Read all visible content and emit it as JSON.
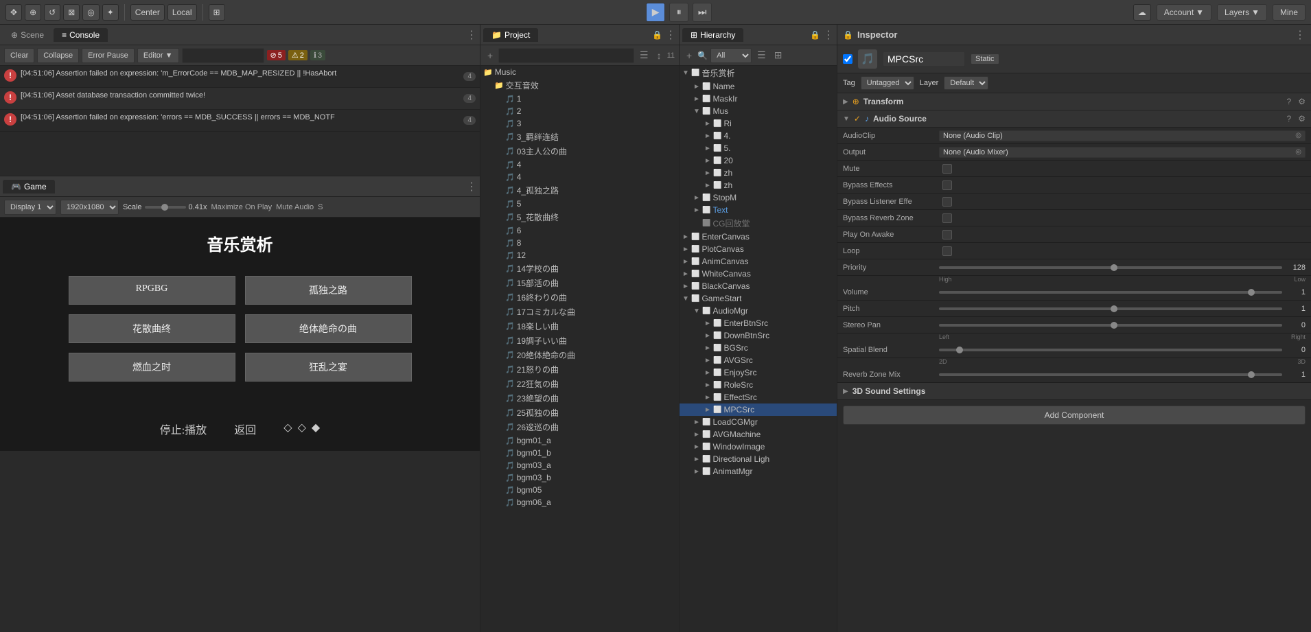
{
  "toolbar": {
    "tools": [
      "✥",
      "⊕",
      "↺",
      "⊠",
      "◎",
      "✦"
    ],
    "pivot_labels": [
      "Center",
      "Local"
    ],
    "grid_label": "⊞",
    "play_btn": "▶",
    "pause_btn": "⏸",
    "step_btn": "⏭",
    "account_label": "Account",
    "layers_label": "Layers",
    "mine_label": "Mine"
  },
  "console": {
    "tab_scene": "Scene",
    "tab_console": "Console",
    "btn_clear": "Clear",
    "btn_collapse": "Collapse",
    "btn_errorpause": "Error Pause",
    "btn_editor": "Editor ▼",
    "badge_error_count": "5",
    "badge_warn_count": "2",
    "badge_info_count": "3",
    "messages": [
      {
        "type": "error",
        "text": "[04:51:06] Assertion failed on expression: 'm_ErrorCode == MDB_MAP_RESIZED || !HasAbort",
        "count": "4"
      },
      {
        "type": "error",
        "text": "[04:51:06] Asset database transaction committed twice!",
        "count": "4"
      },
      {
        "type": "error",
        "text": "[04:51:06] Assertion failed on expression: 'errors == MDB_SUCCESS || errors == MDB_NOTF",
        "count": "4"
      }
    ]
  },
  "game": {
    "tab_label": "Game",
    "display_label": "Display 1",
    "resolution": "1920x1080",
    "scale_label": "Scale",
    "scale_value": "0.41x",
    "maximize_label": "Maximize On Play",
    "mute_label": "Mute Audio",
    "s_label": "S",
    "title": "音乐赏析",
    "buttons": [
      "RPGBG",
      "孤独之路",
      "花散曲终",
      "绝体絶命の曲",
      "燃血之时",
      "狂乱之宴"
    ],
    "bottom_stop": "停止:播放",
    "bottom_return": "返回",
    "bottom_icons": [
      "◇",
      "◇",
      "◆"
    ]
  },
  "project": {
    "tab_label": "Project",
    "lock_icon": "🔒",
    "menu_icon": "⋮",
    "add_btn": "+",
    "search_placeholder": "",
    "tree_items": [
      {
        "label": "Music",
        "type": "folder",
        "indent": 0
      },
      {
        "label": "交互音效",
        "type": "folder",
        "indent": 1
      },
      {
        "label": "1",
        "type": "music",
        "indent": 2
      },
      {
        "label": "2",
        "type": "music",
        "indent": 2
      },
      {
        "label": "3",
        "type": "music",
        "indent": 2
      },
      {
        "label": "3_羁绊连结",
        "type": "music",
        "indent": 2
      },
      {
        "label": "03主人公の曲",
        "type": "music",
        "indent": 2
      },
      {
        "label": "4",
        "type": "music",
        "indent": 2
      },
      {
        "label": "4",
        "type": "music",
        "indent": 2
      },
      {
        "label": "4_孤独之路",
        "type": "music",
        "indent": 2
      },
      {
        "label": "5",
        "type": "music",
        "indent": 2
      },
      {
        "label": "5_花散曲终",
        "type": "music",
        "indent": 2
      },
      {
        "label": "6",
        "type": "music",
        "indent": 2
      },
      {
        "label": "8",
        "type": "music",
        "indent": 2
      },
      {
        "label": "12",
        "type": "music",
        "indent": 2
      },
      {
        "label": "14学校の曲",
        "type": "music",
        "indent": 2
      },
      {
        "label": "15部活の曲",
        "type": "music",
        "indent": 2
      },
      {
        "label": "16終わりの曲",
        "type": "music",
        "indent": 2
      },
      {
        "label": "17コミカルな曲",
        "type": "music",
        "indent": 2
      },
      {
        "label": "18楽しい曲",
        "type": "music",
        "indent": 2
      },
      {
        "label": "19調子いい曲",
        "type": "music",
        "indent": 2
      },
      {
        "label": "20絶体絶命の曲",
        "type": "music",
        "indent": 2
      },
      {
        "label": "21怒りの曲",
        "type": "music",
        "indent": 2
      },
      {
        "label": "22狂気の曲",
        "type": "music",
        "indent": 2
      },
      {
        "label": "23絶望の曲",
        "type": "music",
        "indent": 2
      },
      {
        "label": "25孤独の曲",
        "type": "music",
        "indent": 2
      },
      {
        "label": "26逡巡の曲",
        "type": "music",
        "indent": 2
      },
      {
        "label": "bgm01_a",
        "type": "music",
        "indent": 2
      },
      {
        "label": "bgm01_b",
        "type": "music",
        "indent": 2
      },
      {
        "label": "bgm03_a",
        "type": "music",
        "indent": 2
      },
      {
        "label": "bgm03_b",
        "type": "music",
        "indent": 2
      },
      {
        "label": "bgm05",
        "type": "music",
        "indent": 2
      },
      {
        "label": "bgm06_a",
        "type": "music",
        "indent": 2
      }
    ]
  },
  "hierarchy": {
    "tab_label": "Hierarchy",
    "add_btn": "+",
    "search_all": "All",
    "lock_icon": "🔒",
    "menu_icon": "⋮",
    "items": [
      {
        "label": "音乐赏析",
        "type": "cube",
        "indent": 0,
        "expanded": true
      },
      {
        "label": "Name",
        "type": "cube",
        "indent": 1
      },
      {
        "label": "MaskIr",
        "type": "cube",
        "indent": 1
      },
      {
        "label": "Mus",
        "type": "cube",
        "indent": 1,
        "expanded": true
      },
      {
        "label": "Ri",
        "type": "cube",
        "indent": 2
      },
      {
        "label": "4.",
        "type": "cube",
        "indent": 2
      },
      {
        "label": "5.",
        "type": "cube",
        "indent": 2
      },
      {
        "label": "20",
        "type": "cube",
        "indent": 2
      },
      {
        "label": "zh",
        "type": "cube",
        "indent": 2
      },
      {
        "label": "zh",
        "type": "cube",
        "indent": 2
      },
      {
        "label": "StopM",
        "type": "cube",
        "indent": 1
      },
      {
        "label": "Text",
        "type": "cube",
        "indent": 1,
        "highlighted": true
      },
      {
        "label": "CG回放堂",
        "type": "cube",
        "indent": 1,
        "faded": true
      },
      {
        "label": "EnterCanvas",
        "type": "cube",
        "indent": 0
      },
      {
        "label": "PlotCanvas",
        "type": "cube",
        "indent": 0
      },
      {
        "label": "AnimCanvas",
        "type": "cube",
        "indent": 0
      },
      {
        "label": "WhiteCanvas",
        "type": "cube",
        "indent": 0
      },
      {
        "label": "BlackCanvas",
        "type": "cube",
        "indent": 0
      },
      {
        "label": "GameStart",
        "type": "cube",
        "indent": 0,
        "expanded": true
      },
      {
        "label": "AudioMgr",
        "type": "cube",
        "indent": 1,
        "expanded": true
      },
      {
        "label": "EnterBtnSrc",
        "type": "cube",
        "indent": 2
      },
      {
        "label": "DownBtnSrc",
        "type": "cube",
        "indent": 2
      },
      {
        "label": "BGSrc",
        "type": "cube",
        "indent": 2
      },
      {
        "label": "AVGSrc",
        "type": "cube",
        "indent": 2
      },
      {
        "label": "EnjoySrc",
        "type": "cube",
        "indent": 2
      },
      {
        "label": "RoleSrc",
        "type": "cube",
        "indent": 2
      },
      {
        "label": "EffectSrc",
        "type": "cube",
        "indent": 2
      },
      {
        "label": "MPCSrc",
        "type": "cube",
        "indent": 2,
        "selected": true
      },
      {
        "label": "LoadCGMgr",
        "type": "cube",
        "indent": 1
      },
      {
        "label": "AVGMachine",
        "type": "cube",
        "indent": 1
      },
      {
        "label": "WindowImage",
        "type": "cube",
        "indent": 1
      },
      {
        "label": "Directional Ligh",
        "type": "cube",
        "indent": 1
      },
      {
        "label": "AnimatMgr",
        "type": "cube",
        "indent": 1
      }
    ]
  },
  "inspector": {
    "tab_label": "Inspector",
    "lock_icon": "🔒",
    "menu_icon": "⋮",
    "object_name": "MPCSrc",
    "static_label": "Static",
    "tag_label": "Tag",
    "tag_value": "Untagged",
    "layer_label": "Layer",
    "layer_value": "Default",
    "transform_label": "Transform",
    "audio_source_label": "Audio Source",
    "fields": {
      "audio_clip_label": "AudioClip",
      "audio_clip_value": "None (Audio Clip)",
      "output_label": "Output",
      "output_value": "None (Audio Mixer)",
      "mute_label": "Mute",
      "bypass_effects_label": "Bypass Effects",
      "bypass_listener_label": "Bypass Listener Effe",
      "bypass_reverb_label": "Bypass Reverb Zone",
      "play_on_awake_label": "Play On Awake",
      "loop_label": "Loop",
      "priority_label": "Priority",
      "priority_value": "128",
      "priority_high": "High",
      "priority_low": "Low",
      "volume_label": "Volume",
      "volume_value": "1",
      "pitch_label": "Pitch",
      "pitch_value": "1",
      "stereo_pan_label": "Stereo Pan",
      "stereo_pan_value": "0",
      "stereo_left": "Left",
      "stereo_right": "Right",
      "spatial_blend_label": "Spatial Blend",
      "spatial_blend_value": "0",
      "spatial_2d": "2D",
      "spatial_3d": "3D",
      "reverb_zone_label": "Reverb Zone Mix",
      "reverb_zone_value": "1",
      "sound_settings_label": "3D Sound Settings",
      "add_component_label": "Add Component"
    }
  }
}
